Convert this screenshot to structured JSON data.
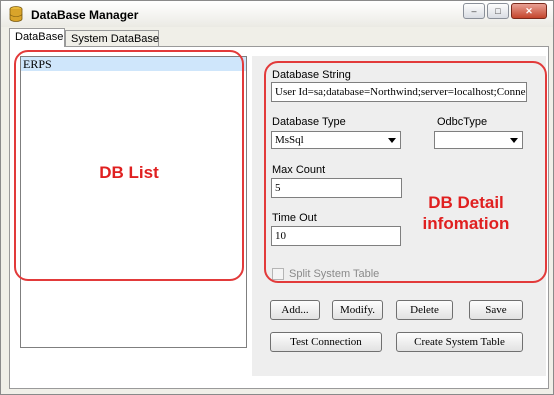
{
  "window": {
    "title": "DataBase Manager",
    "controls": {
      "minimize": "–",
      "maximize": "□",
      "close": "✕"
    }
  },
  "tabs": [
    {
      "label": "DataBase",
      "active": true
    },
    {
      "label": "System DataBase",
      "active": false
    }
  ],
  "db_list": {
    "items": [
      "ERPS"
    ],
    "selected": "ERPS"
  },
  "details": {
    "database_string_label": "Database String",
    "database_string_value": "User Id=sa;database=Northwind;server=localhost;Connect",
    "database_type_label": "Database Type",
    "database_type_value": "MsSql",
    "odbc_type_label": "OdbcType",
    "odbc_type_value": "",
    "max_count_label": "Max Count",
    "max_count_value": "5",
    "time_out_label": "Time Out",
    "time_out_value": "10",
    "split_system_table_label": "Split System Table",
    "split_system_table_checked": false
  },
  "buttons": {
    "add": "Add...",
    "modify": "Modify.",
    "delete": "Delete",
    "save": "Save",
    "test_connection": "Test Connection",
    "create_system_table": "Create System Table"
  },
  "annotations": {
    "db_list": "DB List",
    "db_detail_line1": "DB Detail",
    "db_detail_line2": "infomation"
  },
  "colors": {
    "annotation": "#e02020",
    "selection": "#cfe6fb",
    "close_button": "#c4452c"
  }
}
